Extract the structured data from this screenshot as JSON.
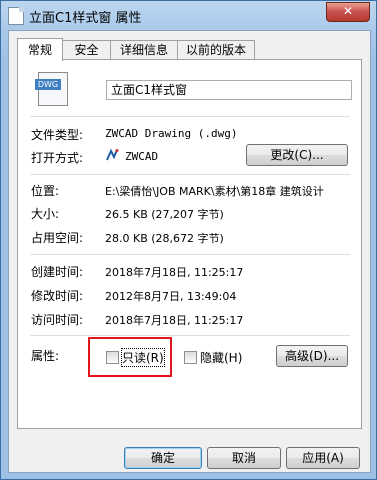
{
  "window": {
    "title": "立面C1样式窗 属性",
    "close_label": "✕"
  },
  "tabs": [
    {
      "label": "常规",
      "active": true
    },
    {
      "label": "安全",
      "active": false
    },
    {
      "label": "详细信息",
      "active": false
    },
    {
      "label": "以前的版本",
      "active": false
    }
  ],
  "file": {
    "icon_text": "DWG",
    "name": "立面C1样式窗",
    "type_label": "文件类型:",
    "type_value": "ZWCAD Drawing (.dwg)",
    "open_with_label": "打开方式:",
    "open_with_value": "ZWCAD",
    "change_button": "更改(C)...",
    "location_label": "位置:",
    "location_value": "E:\\梁倩怡\\JOB MARK\\素材\\第18章 建筑设计",
    "size_label": "大小:",
    "size_value": "26.5 KB (27,207 字节)",
    "disk_size_label": "占用空间:",
    "disk_size_value": "28.0 KB (28,672 字节)",
    "created_label": "创建时间:",
    "created_value": "2018年7月18日, 11:25:17",
    "modified_label": "修改时间:",
    "modified_value": "2012年8月7日, 13:49:04",
    "accessed_label": "访问时间:",
    "accessed_value": "2018年7月18日, 11:25:17",
    "attributes_label": "属性:",
    "readonly_label": "只读(R)",
    "hidden_label": "隐藏(H)",
    "advanced_button": "高级(D)..."
  },
  "footer": {
    "ok": "确定",
    "cancel": "取消",
    "apply": "应用(A)"
  },
  "colors": {
    "highlight_box": "#e0161b"
  }
}
